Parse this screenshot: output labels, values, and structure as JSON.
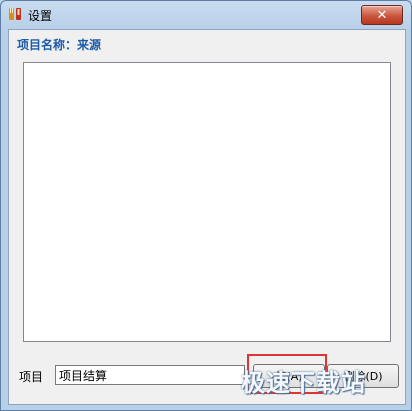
{
  "window": {
    "title": "设置",
    "close_label": "✕"
  },
  "header": {
    "project_name_label": "项目名称：来源"
  },
  "list": {
    "items": []
  },
  "form": {
    "field_label": "项目",
    "field_value": "项目结算"
  },
  "buttons": {
    "add_label": "加(A)",
    "delete_label": "删除(D)"
  },
  "watermark": {
    "text": "极速下载站"
  },
  "colors": {
    "header_text": "#1d5ba8",
    "highlight_border": "#e03434",
    "close_button": "#c9563e"
  }
}
